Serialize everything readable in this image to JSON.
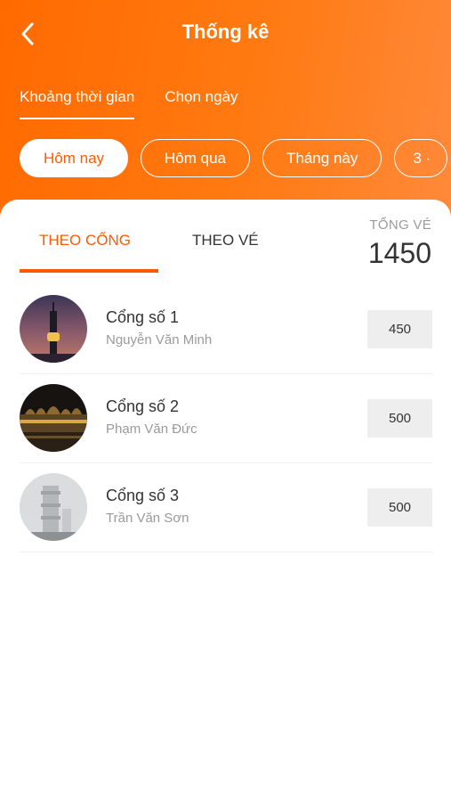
{
  "header": {
    "title": "Thống kê",
    "back_icon": "chevron-left-icon",
    "range_tabs": [
      {
        "label": "Khoảng thời gian",
        "active": true
      },
      {
        "label": "Chọn ngày",
        "active": false
      }
    ],
    "chips": [
      {
        "label": "Hôm nay",
        "active": true
      },
      {
        "label": "Hôm qua",
        "active": false
      },
      {
        "label": "Tháng này",
        "active": false
      },
      {
        "label": "3 ·",
        "active": false
      }
    ],
    "colors": {
      "accent": "#ff5a00",
      "gradient_start": "#ff6a00",
      "gradient_end": "#ff8a3c"
    }
  },
  "stats": {
    "tabs": [
      {
        "label": "THEO CỔNG",
        "active": true
      },
      {
        "label": "THEO VÉ",
        "active": false
      }
    ],
    "total_label": "TỔNG VÉ",
    "total_value": "1450"
  },
  "gates": [
    {
      "name": "Cổng số 1",
      "person": "Nguyễn Văn Minh",
      "count": "450"
    },
    {
      "name": "Cổng số 2",
      "person": "Phạm Văn Đức",
      "count": "500"
    },
    {
      "name": "Cổng số 3",
      "person": "Trần Văn Sơn",
      "count": "500"
    }
  ]
}
